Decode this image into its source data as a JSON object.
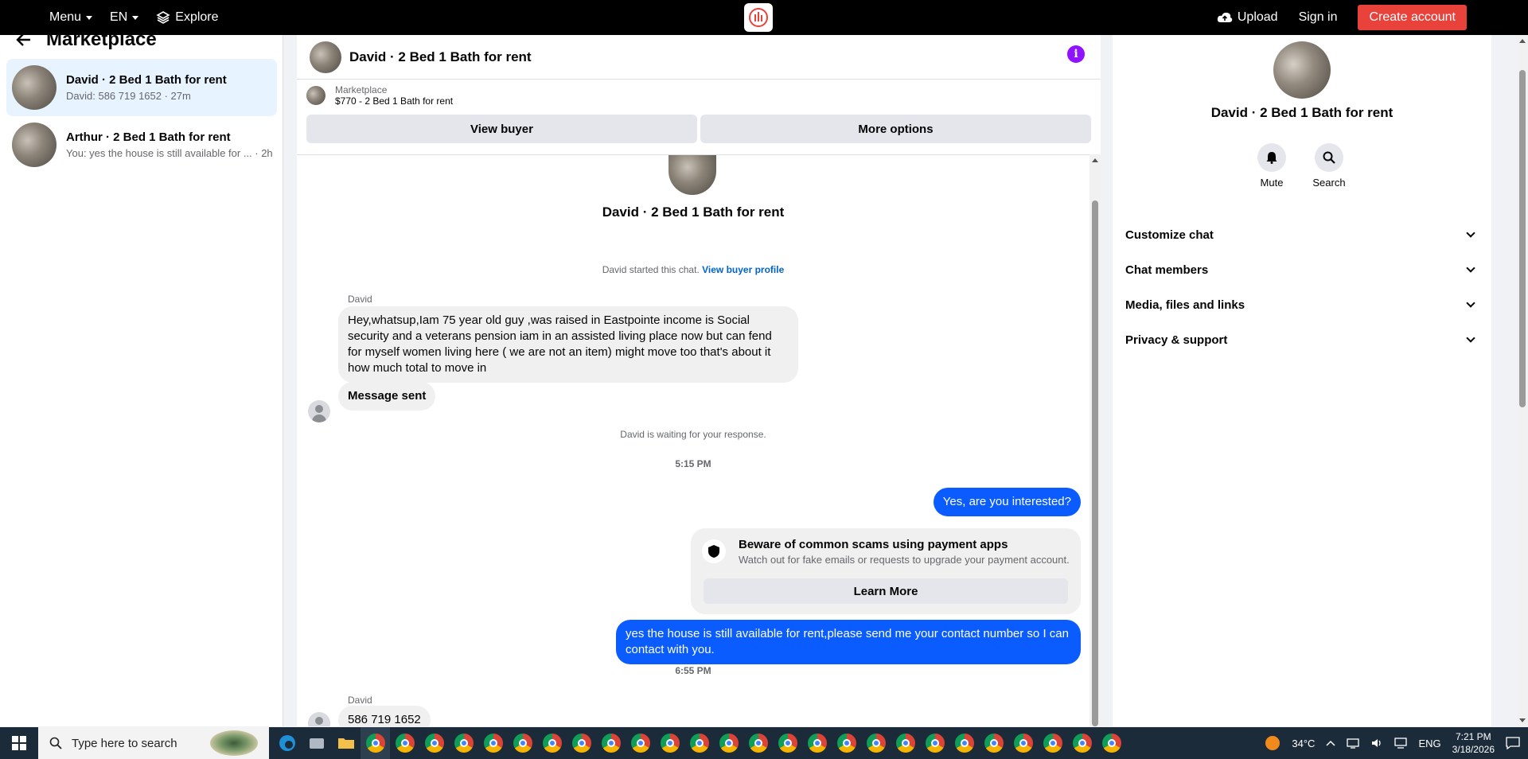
{
  "topbar": {
    "menu": "Menu",
    "lang": "EN",
    "explore": "Explore",
    "upload": "Upload",
    "signin": "Sign in",
    "create": "Create account"
  },
  "sidebar": {
    "title": "Marketplace",
    "conversations": [
      {
        "title": "David · 2 Bed 1 Bath for rent",
        "preview": "David: 586 719 1652 · 27m"
      },
      {
        "title": "Arthur · 2 Bed 1 Bath for rent",
        "preview": "You: yes the house is still available for ... · 2h"
      }
    ]
  },
  "thread": {
    "header_name": "David · 2 Bed 1 Bath for rent",
    "listing_source": "Marketplace",
    "listing_title": "$770 - 2 Bed 1 Bath for rent",
    "view_buyer": "View buyer",
    "more_options": "More options",
    "chat_title": "David · 2 Bed 1 Bath for rent",
    "started_text": "David started this chat.",
    "view_profile": "View buyer profile",
    "sender1": "David",
    "msg1": "Hey,whatsup,Iam 75 year old guy ,was raised in Eastpointe income is Social security and a veterans pension iam in an assisted  living place now but can fend for myself women living here ( we are not an item) might move too that's about it how much total to move in",
    "msg2": "Message sent",
    "waiting": "David is waiting for your response.",
    "time1": "5:15 PM",
    "out1": "Yes, are you interested?",
    "warn_title": "Beware of common scams using payment apps",
    "warn_text": "Watch out for fake emails or requests to upgrade your payment account.",
    "learn_more": "Learn More",
    "out2": "yes the house is still available for rent,please send me your contact number so I can contact with you.",
    "time2": "6:55 PM",
    "sender2": "David",
    "msg3": "586 719 1652"
  },
  "details": {
    "name": "David · 2 Bed 1 Bath for rent",
    "mute": "Mute",
    "search": "Search",
    "sections": [
      "Customize chat",
      "Chat members",
      "Media, files and links",
      "Privacy & support"
    ]
  },
  "taskbar": {
    "search_placeholder": "Type here to search",
    "temp": "34°C",
    "lang": "ENG",
    "time": "7:21 PM",
    "date": "3/18/2026"
  },
  "colors": {
    "accent": "#0a5cff",
    "create_button": "#e8423b",
    "info_icon": "#9012fe"
  }
}
